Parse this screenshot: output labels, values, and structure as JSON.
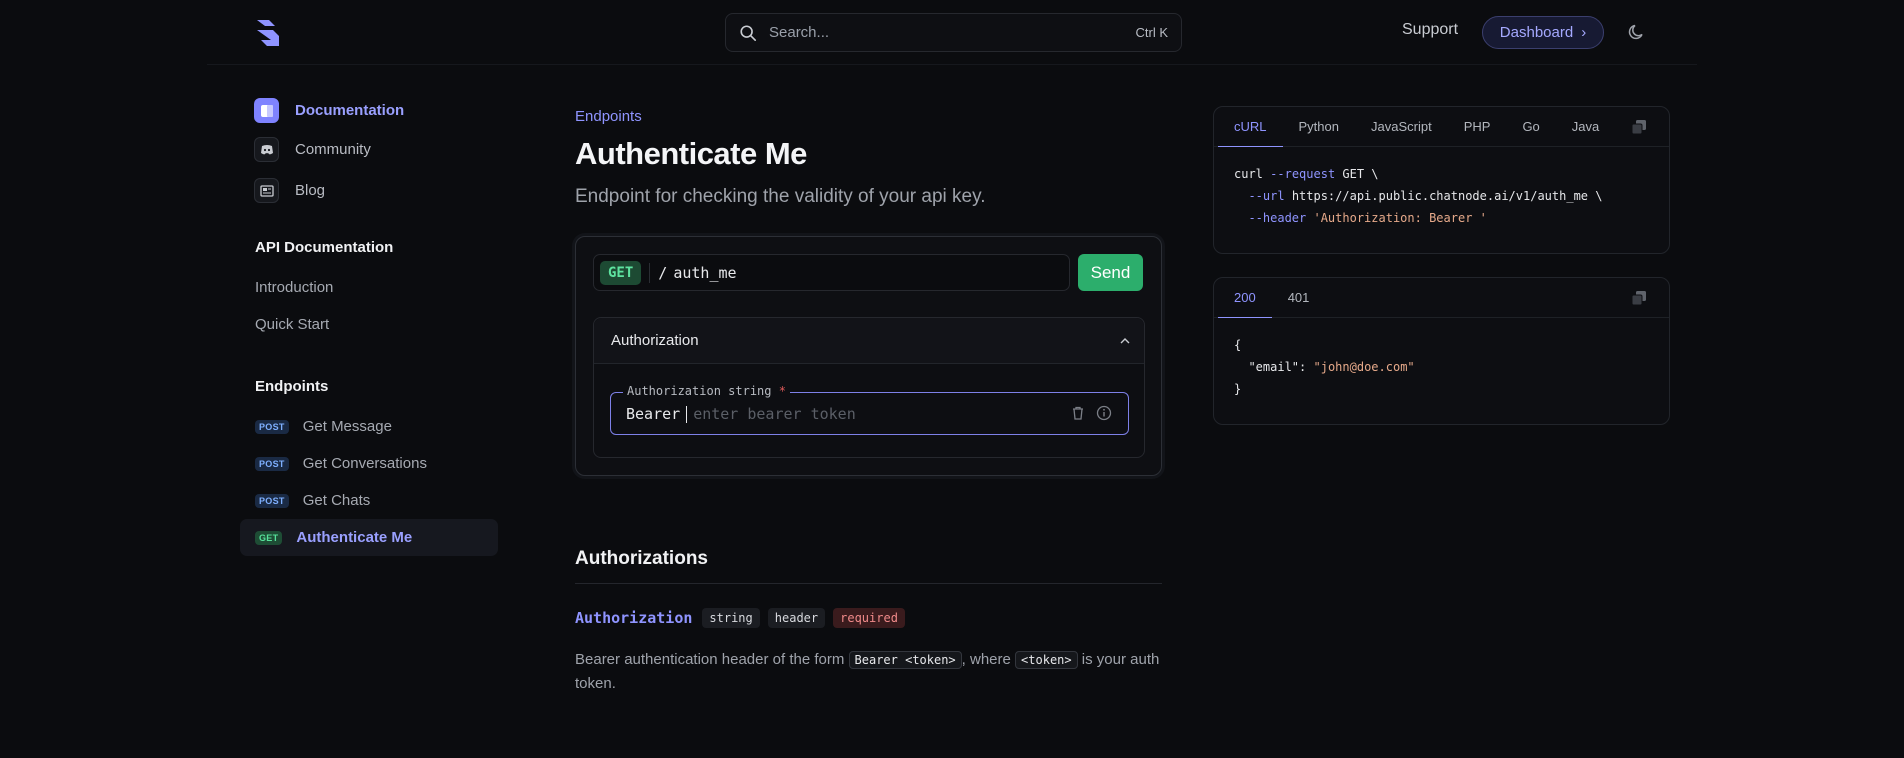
{
  "header": {
    "search_placeholder": "Search...",
    "search_shortcut": "Ctrl K",
    "support_label": "Support",
    "dashboard_label": "Dashboard"
  },
  "sidebar": {
    "links": [
      {
        "label": "Documentation",
        "icon": "book-icon"
      },
      {
        "label": "Community",
        "icon": "discord-icon"
      },
      {
        "label": "Blog",
        "icon": "newspaper-icon"
      }
    ],
    "api_heading": "API Documentation",
    "api_items": [
      "Introduction",
      "Quick Start"
    ],
    "endpoints_heading": "Endpoints",
    "endpoints": [
      {
        "method": "POST",
        "label": "Get Message"
      },
      {
        "method": "POST",
        "label": "Get Conversations"
      },
      {
        "method": "POST",
        "label": "Get Chats"
      },
      {
        "method": "GET",
        "label": "Authenticate Me"
      }
    ]
  },
  "main": {
    "breadcrumb": "Endpoints",
    "title": "Authenticate Me",
    "description": "Endpoint for checking the validity of your api key.",
    "playground": {
      "method": "GET",
      "separator": "/",
      "path": "auth_me",
      "send_label": "Send",
      "auth_section_label": "Authorization",
      "field_label": "Authorization",
      "field_type": "string",
      "field_required_mark": "*",
      "field_prefix": "Bearer",
      "field_placeholder": "enter bearer token"
    },
    "authorizations": {
      "title": "Authorizations",
      "param_name": "Authorization",
      "chips": [
        "string",
        "header"
      ],
      "required_label": "required",
      "desc_1": "Bearer authentication header of the form",
      "code_1": "Bearer <token>",
      "desc_2": ", where",
      "code_2": "<token>",
      "desc_3": "is your auth token."
    }
  },
  "request_panel": {
    "tabs": [
      "cURL",
      "Python",
      "JavaScript",
      "PHP",
      "Go",
      "Java"
    ],
    "active_tab": "cURL",
    "code": {
      "l1_cmd": "curl",
      "l1_flag": "--request",
      "l1_rest": "GET \\",
      "l2_flag": "--url",
      "l2_rest": "https://api.public.chatnode.ai/v1/auth_me \\",
      "l3_flag": "--header",
      "l3_str": "'Authorization: Bearer '"
    }
  },
  "response_panel": {
    "tabs": [
      "200",
      "401"
    ],
    "active_tab": "200",
    "code": {
      "open": "{",
      "key": "\"email\"",
      "colon": ":",
      "value": "\"john@doe.com\"",
      "close": "}"
    }
  },
  "colors": {
    "accent": "#8f94ff",
    "send": "#2cae6c",
    "get_badge": "#57e39b",
    "post_badge": "#7fb0ff"
  }
}
